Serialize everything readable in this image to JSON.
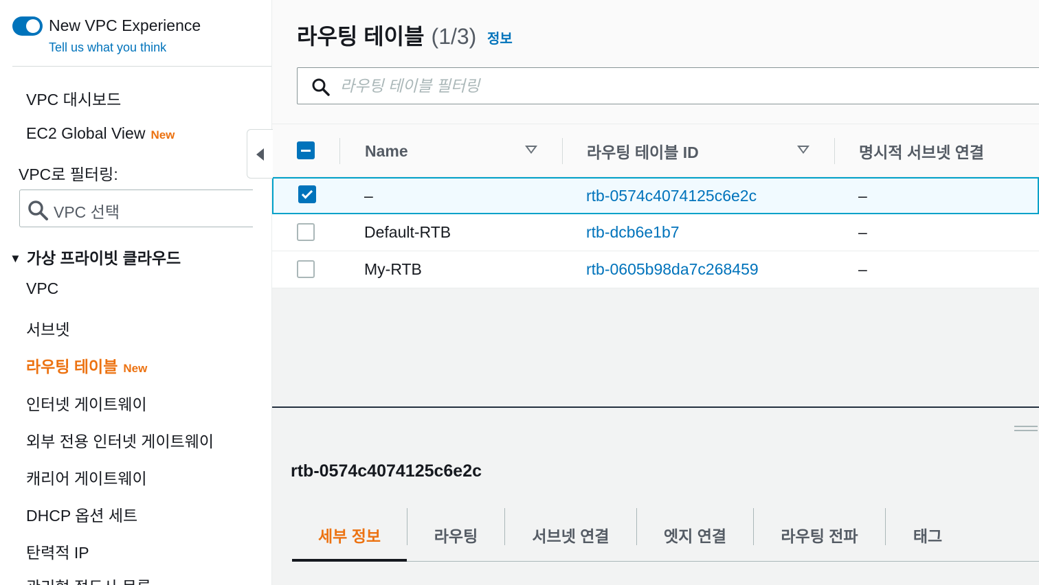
{
  "sidebar": {
    "experience_title": "New VPC Experience",
    "feedback_link": "Tell us what you think",
    "dashboard": "VPC 대시보드",
    "ec2_global_view": "EC2 Global View",
    "new_badge": "New",
    "filter_label": "VPC로 필터링:",
    "vpc_select_placeholder": "VPC 선택",
    "section_title": "가상 프라이빗 클라우드",
    "items": [
      {
        "label": "VPC"
      },
      {
        "label": "서브넷"
      },
      {
        "label": "라우팅 테이블",
        "badge": "New",
        "active": true
      },
      {
        "label": "인터넷 게이트웨이"
      },
      {
        "label": "외부 전용 인터넷 게이트웨이"
      },
      {
        "label": "캐리어 게이트웨이"
      },
      {
        "label": "DHCP 옵션 세트"
      },
      {
        "label": "탄력적 IP"
      },
      {
        "label": "관리형 접두사 목록"
      }
    ]
  },
  "main": {
    "title": "라우팅 테이블",
    "count": "(1/3)",
    "info_link": "정보",
    "search_placeholder": "라우팅 테이블 필터링",
    "columns": [
      "Name",
      "라우팅 테이블 ID",
      "명시적 서브넷 연결"
    ],
    "rows": [
      {
        "name": "–",
        "id": "rtb-0574c4074125c6e2c",
        "subnet": "–",
        "selected": true
      },
      {
        "name": "Default-RTB",
        "id": "rtb-dcb6e1b7",
        "subnet": "–",
        "selected": false
      },
      {
        "name": "My-RTB",
        "id": "rtb-0605b98da7c268459",
        "subnet": "–",
        "selected": false
      }
    ]
  },
  "details": {
    "title": "rtb-0574c4074125c6e2c",
    "tabs": [
      "세부 정보",
      "라우팅",
      "서브넷 연결",
      "엣지 연결",
      "라우팅 전파",
      "태그"
    ],
    "active_tab": "세부 정보"
  },
  "colors": {
    "accent_orange": "#ec7211",
    "link_blue": "#0073bb",
    "selected_row_border": "#00a1c9"
  },
  "icons": {
    "search": "search-icon",
    "collapse": "collapse-left-icon",
    "sort": "sort-caret-icon",
    "section_caret": "caret-down-icon"
  }
}
